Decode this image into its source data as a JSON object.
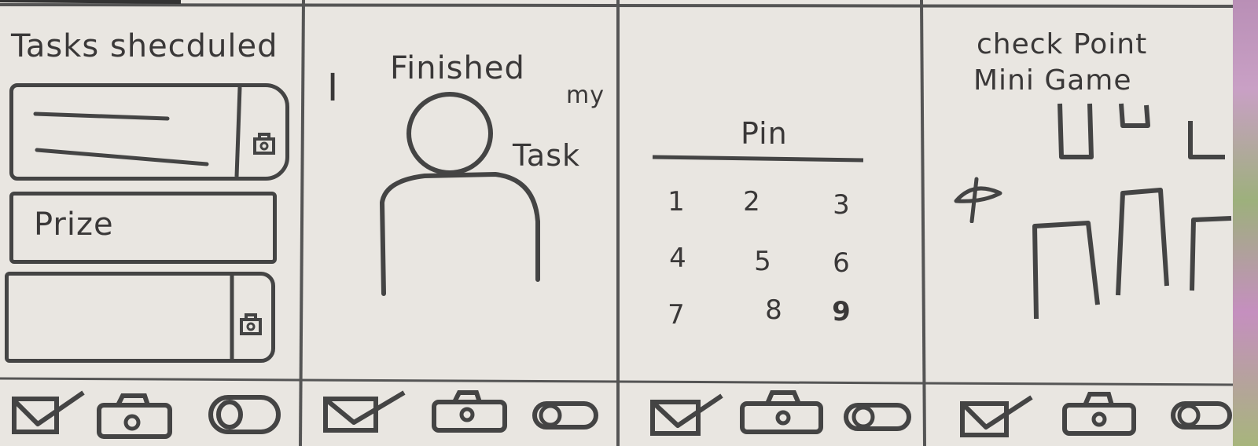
{
  "frames": [
    {
      "title": "Tasks shecduled",
      "cards": [
        {
          "label": "",
          "locked": true
        },
        {
          "label": "Prize",
          "locked": false
        },
        {
          "label": "",
          "locked": true
        }
      ]
    },
    {
      "title_words": [
        "I",
        "Finished",
        "my",
        "Task"
      ]
    },
    {
      "pin_label": "Pin",
      "keys": [
        "1",
        "2",
        "3",
        "4",
        "5",
        "6",
        "7",
        "8",
        "9"
      ]
    },
    {
      "title_line1": "check Point",
      "title_line2": "Mini Game"
    }
  ],
  "nav": [
    {
      "icon": "checkbox-icon"
    },
    {
      "icon": "camera-icon"
    },
    {
      "icon": "toggle-icon"
    }
  ],
  "colors": {
    "paper": "#e9e6e1",
    "ink": "#444444"
  }
}
